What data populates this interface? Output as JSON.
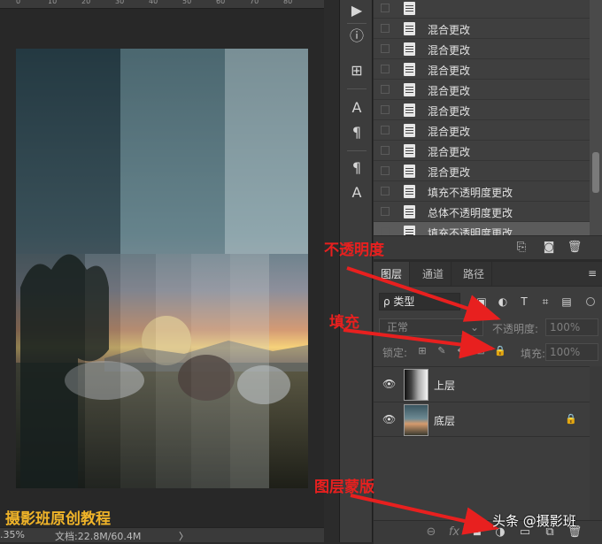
{
  "ruler": {
    "labels": [
      "0",
      "10",
      "20",
      "30",
      "40",
      "50",
      "60",
      "70",
      "80"
    ]
  },
  "watermark_left": "摄影班原创教程",
  "status": {
    "zoom": ".35%",
    "doc": "文档:22.8M/60.4M",
    "arrow": "〉"
  },
  "tools": [
    {
      "icon": "play-icon",
      "glyph": "▶"
    },
    {
      "icon": "info-icon",
      "glyph": "ⓘ"
    },
    {
      "icon": "tool-presets-icon",
      "glyph": "⊞"
    },
    {
      "icon": "character-icon",
      "glyph": "A"
    },
    {
      "icon": "paragraph-icon",
      "glyph": "¶"
    },
    {
      "icon": "paragraph-style-icon",
      "glyph": "¶"
    },
    {
      "icon": "character-style-icon",
      "glyph": "A"
    }
  ],
  "history": {
    "items": [
      {
        "label": "",
        "active": false
      },
      {
        "label": "混合更改",
        "active": false
      },
      {
        "label": "混合更改",
        "active": false
      },
      {
        "label": "混合更改",
        "active": false
      },
      {
        "label": "混合更改",
        "active": false
      },
      {
        "label": "混合更改",
        "active": false
      },
      {
        "label": "混合更改",
        "active": false
      },
      {
        "label": "混合更改",
        "active": false
      },
      {
        "label": "混合更改",
        "active": false
      },
      {
        "label": "填充不透明度更改",
        "active": false
      },
      {
        "label": "总体不透明度更改",
        "active": false
      },
      {
        "label": "填充不透明度更改",
        "active": true
      }
    ],
    "scroll_position": 0.78
  },
  "layers": {
    "tabs": [
      "图层",
      "通道",
      "路径"
    ],
    "active_tab": "图层",
    "menu_glyph": "≡",
    "filter": {
      "label": "ρ 类型",
      "kind_icons": [
        "image-filter-icon",
        "adjustment-filter-icon",
        "type-filter-icon",
        "shape-filter-icon",
        "smartobject-filter-icon"
      ],
      "kind_glyphs": [
        "▣",
        "◐",
        "T",
        "⌗",
        "▤"
      ]
    },
    "blend_mode": "正常",
    "opacity_label": "不透明度:",
    "opacity_value": "100%",
    "lock_label": "锁定:",
    "lock_glyphs": [
      "⊞",
      "✎",
      "✥",
      "⊡",
      "🔒"
    ],
    "fill_label": "填充:",
    "fill_value": "100%",
    "items": [
      {
        "name": "上层",
        "visible": true,
        "locked": false
      },
      {
        "name": "底层",
        "visible": true,
        "locked": true
      }
    ],
    "footer_glyphs": [
      "⊖",
      "fx",
      "◘",
      "◑",
      "▭",
      "⧉",
      "🗑"
    ]
  },
  "annotations": {
    "opacity": "不透明度",
    "fill": "填充",
    "mask": "图层蒙版"
  },
  "watermark_right": "头条 @摄影班",
  "colors": {
    "annotation": "#e8201f",
    "watermark": "#f0b429",
    "panel_bg": "#3d3d3d"
  }
}
